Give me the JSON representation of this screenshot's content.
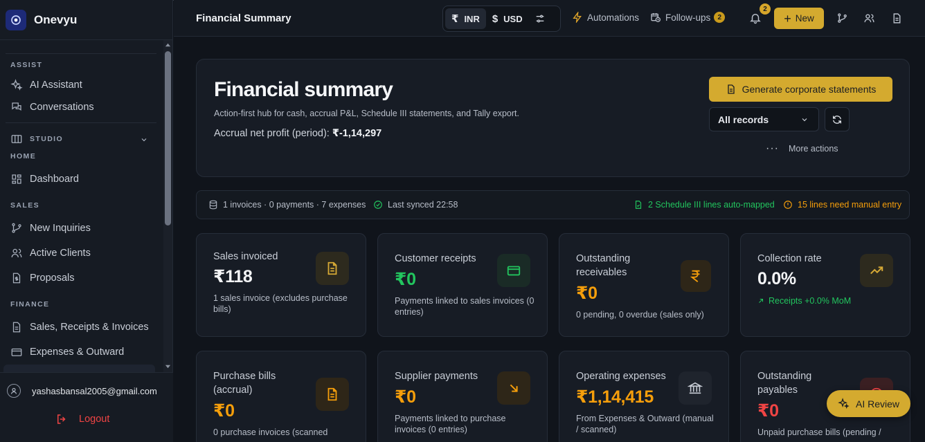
{
  "brand": {
    "name": "Onevyu"
  },
  "sidebar": {
    "sections": {
      "assist": "ASSIST",
      "studio": "STUDIO",
      "home": "HOME",
      "sales": "SALES",
      "finance": "FINANCE"
    },
    "items": {
      "ai_assistant": "AI Assistant",
      "conversations": "Conversations",
      "dashboard": "Dashboard",
      "new_inquiries": "New Inquiries",
      "active_clients": "Active Clients",
      "proposals": "Proposals",
      "sales_receipts": "Sales, Receipts & Invoices",
      "expenses_outward": "Expenses & Outward"
    },
    "user_email": "yashasbansal2005@gmail.com",
    "logout_label": "Logout"
  },
  "topbar": {
    "title": "Financial Summary",
    "currency_inr": "INR",
    "currency_usd": "USD",
    "automations": "Automations",
    "followups": "Follow-ups",
    "followups_count": "2",
    "notifications_count": "2",
    "new_label": "New"
  },
  "hero": {
    "title": "Financial summary",
    "subtitle": "Action-first hub for cash, accrual P&L, Schedule III statements, and Tally export.",
    "profit_label": "Accrual net profit (period):",
    "profit_value": "₹-1,14,297",
    "generate_label": "Generate corporate statements",
    "records_select": "All records",
    "more_actions": "More actions"
  },
  "status": {
    "counts": "1 invoices · 0 payments · 7 expenses",
    "synced": "Last synced 22:58",
    "auto_mapped": "2 Schedule III lines auto-mapped",
    "manual_entry": "15 lines need manual entry"
  },
  "cards": [
    {
      "label": "Sales invoiced",
      "value": "₹118",
      "note": "1 sales invoice (excludes purchase bills)",
      "icon": "document-icon"
    },
    {
      "label": "Customer receipts",
      "value": "₹0",
      "note": "Payments linked to sales invoices (0 entries)",
      "icon": "card-icon"
    },
    {
      "label": "Outstanding receivables",
      "value": "₹0",
      "note": "0 pending, 0 overdue (sales only)",
      "icon": "rupee-icon"
    },
    {
      "label": "Collection rate",
      "value": "0.0%",
      "note": "Receipts +0.0% MoM",
      "icon": "trending-up-icon"
    },
    {
      "label": "Purchase bills (accrual)",
      "value": "₹0",
      "note": "0 purchase invoices (scanned",
      "icon": "document-icon"
    },
    {
      "label": "Supplier payments",
      "value": "₹0",
      "note": "Payments linked to purchase invoices (0 entries)",
      "icon": "arrow-down-right-icon"
    },
    {
      "label": "Operating expenses",
      "value": "₹1,14,415",
      "note": "From Expenses & Outward (manual / scanned)",
      "icon": "bank-icon"
    },
    {
      "label": "Outstanding payables",
      "value": "₹0",
      "note": "Unpaid purchase bills (pending /",
      "icon": "alert-icon"
    }
  ],
  "ai_review_label": "AI Review",
  "colors": {
    "accent": "#d4aa2f",
    "positive": "#22c55e",
    "warning": "#f59e0b",
    "negative": "#ef4444"
  }
}
